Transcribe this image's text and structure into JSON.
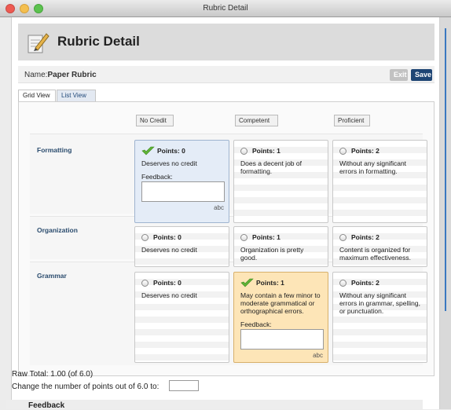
{
  "window": {
    "title": "Rubric Detail"
  },
  "header": {
    "title": "Rubric Detail",
    "icon": "rubric-pencil-icon"
  },
  "name_bar": {
    "label": "Name:",
    "value": "Paper Rubric",
    "exit_label": "Exit",
    "save_label": "Save"
  },
  "tabs": [
    {
      "label": "Grid View",
      "active": true
    },
    {
      "label": "List View",
      "active": false
    }
  ],
  "columns": [
    {
      "label": "No Credit"
    },
    {
      "label": "Competent"
    },
    {
      "label": "Proficient"
    }
  ],
  "rows": [
    {
      "label": "Formatting",
      "cells": [
        {
          "points": "Points: 0",
          "desc": "Deserves no credit",
          "selected": true,
          "feedback_label": "Feedback:"
        },
        {
          "points": "Points: 1",
          "desc": "Does a decent job of formatting.",
          "selected": false
        },
        {
          "points": "Points: 2",
          "desc": "Without any significant errors in formatting.",
          "selected": false
        }
      ]
    },
    {
      "label": "Organization",
      "cells": [
        {
          "points": "Points: 0",
          "desc": "Deserves no credit",
          "selected": false
        },
        {
          "points": "Points: 1",
          "desc": "Organization is pretty good.",
          "selected": false
        },
        {
          "points": "Points: 2",
          "desc": "Content is organized for maximum effectiveness.",
          "selected": false
        }
      ]
    },
    {
      "label": "Grammar",
      "cells": [
        {
          "points": "Points: 0",
          "desc": "Deserves no credit",
          "selected": false
        },
        {
          "points": "Points: 1",
          "desc": "May contain a few minor to moderate grammatical or orthographical errors.",
          "selected": true,
          "feedback_label": "Feedback:"
        },
        {
          "points": "Points: 2",
          "desc": "Without any significant errors in grammar, spelling, or punctuation.",
          "selected": false
        }
      ]
    }
  ],
  "spellcheck_label": "abc",
  "totals": {
    "raw_total": "Raw Total: 1.00 (of 6.0)",
    "change_label": "Change the number of points out of 6.0 to:",
    "change_value": ""
  },
  "feedback_section": {
    "title": "Feedback"
  },
  "colors": {
    "save_button": "#1e4574",
    "selected_blue": "#e4ecf7",
    "selected_yellow": "#fde5b7",
    "row_label": "#2b4c6e"
  }
}
